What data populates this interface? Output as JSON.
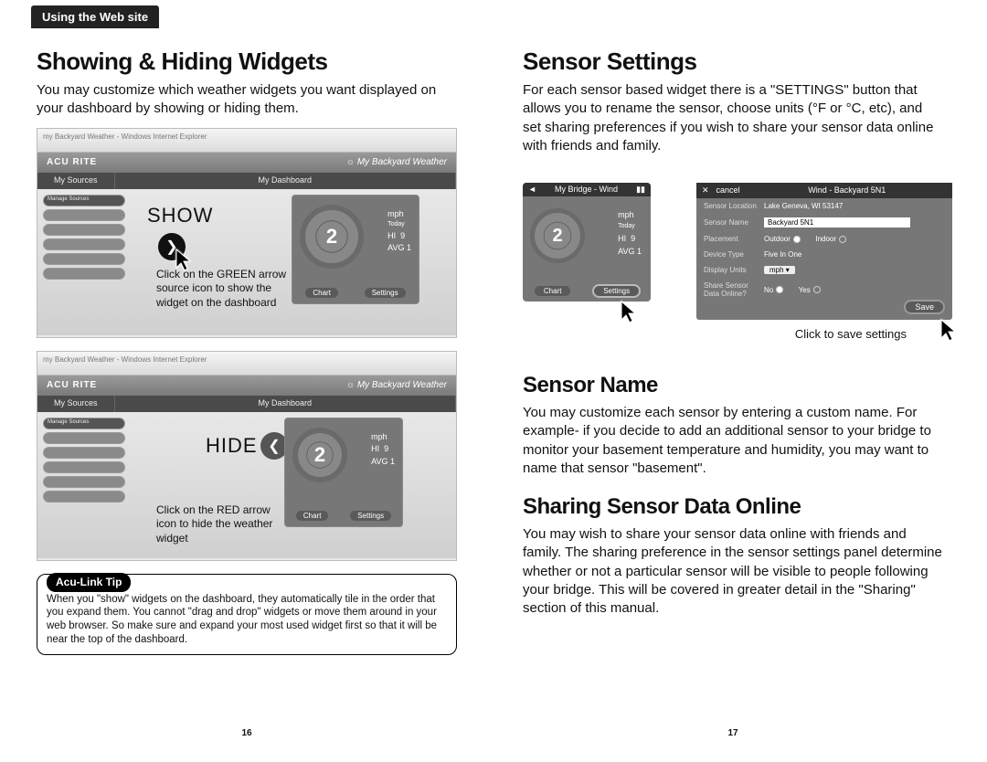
{
  "header": {
    "tab": "Using the Web site"
  },
  "left": {
    "h1": "Showing & Hiding Widgets",
    "p1": "You may customize which weather widgets you want displayed on your dashboard by showing or hiding them.",
    "fig1": {
      "brand_left": "ACU RITE",
      "brand_right": "My Backyard Weather",
      "tab1": "My Sources",
      "tab2": "My Dashboard",
      "label": "SHOW",
      "callout": "Click on the GREEN arrow source icon to show the widget on the dashboard",
      "wind_unit": "mph",
      "wind_hi_label": "HI",
      "wind_hi": "9",
      "wind_avg_label": "AVG",
      "wind_avg": "1",
      "wind_val": "2",
      "btn_chart": "Chart",
      "btn_settings": "Settings",
      "today": "Today"
    },
    "fig2": {
      "brand_left": "ACU RITE",
      "brand_right": "My Backyard Weather",
      "tab1": "My Sources",
      "tab2": "My Dashboard",
      "label": "HIDE",
      "callout": "Click on the RED arrow icon to hide the weather widget",
      "wind_unit": "mph",
      "wind_hi_label": "HI",
      "wind_hi": "9",
      "wind_avg_label": "AVG",
      "wind_avg": "1",
      "wind_val": "2",
      "btn_chart": "Chart",
      "btn_settings": "Settings"
    },
    "tip": {
      "title": "Acu-Link Tip",
      "body": "When you \"show\" widgets on the dashboard, they automatically tile in the order that you expand them. You cannot \"drag and drop\" widgets or move them around in your web browser. So make sure and expand your most used widget first so that it will be near the top of the dashboard."
    },
    "pagenum": "16"
  },
  "right": {
    "h1": "Sensor Settings",
    "p1": "For each sensor based widget there is a \"SETTINGS\" button that allows you to rename the sensor, choose units (°F or °C, etc), and set sharing preferences if you wish to share your sensor data online with friends and family.",
    "settings_fig": {
      "mini_title": "My Bridge - Wind",
      "mini_unit": "mph",
      "mini_today": "Today",
      "mini_hi_label": "HI",
      "mini_hi": "9",
      "mini_avg_label": "AVG",
      "mini_avg": "1",
      "mini_val": "2",
      "mini_chart": "Chart",
      "mini_settings": "Settings",
      "panel_cancel": "cancel",
      "panel_title": "Wind - Backyard 5N1",
      "loc_label": "Sensor Location",
      "loc_value": "Lake Geneva, WI 53147",
      "name_label": "Sensor Name",
      "name_value": "Backyard 5N1",
      "place_label": "Placement",
      "place_out": "Outdoor",
      "place_in": "Indoor",
      "type_label": "Device Type",
      "type_value": "Five In One",
      "units_label": "Display Units",
      "units_value": "mph",
      "share_label": "Share Sensor Data Online?",
      "share_no": "No",
      "share_yes": "Yes",
      "save": "Save",
      "caption": "Click to save settings"
    },
    "h2": "Sensor Name",
    "p2": "You may customize each sensor by entering a custom name. For example- if you decide to add an additional sensor to your bridge to monitor your basement temperature and humidity, you may want to name that sensor \"basement\".",
    "h3": "Sharing Sensor Data Online",
    "p3": "You may wish to share your sensor data online with friends and family. The sharing preference in the sensor settings panel determine whether or not a particular sensor will be visible to people following your bridge. This will be covered in greater detail in the \"Sharing\" section of this manual.",
    "pagenum": "17"
  }
}
